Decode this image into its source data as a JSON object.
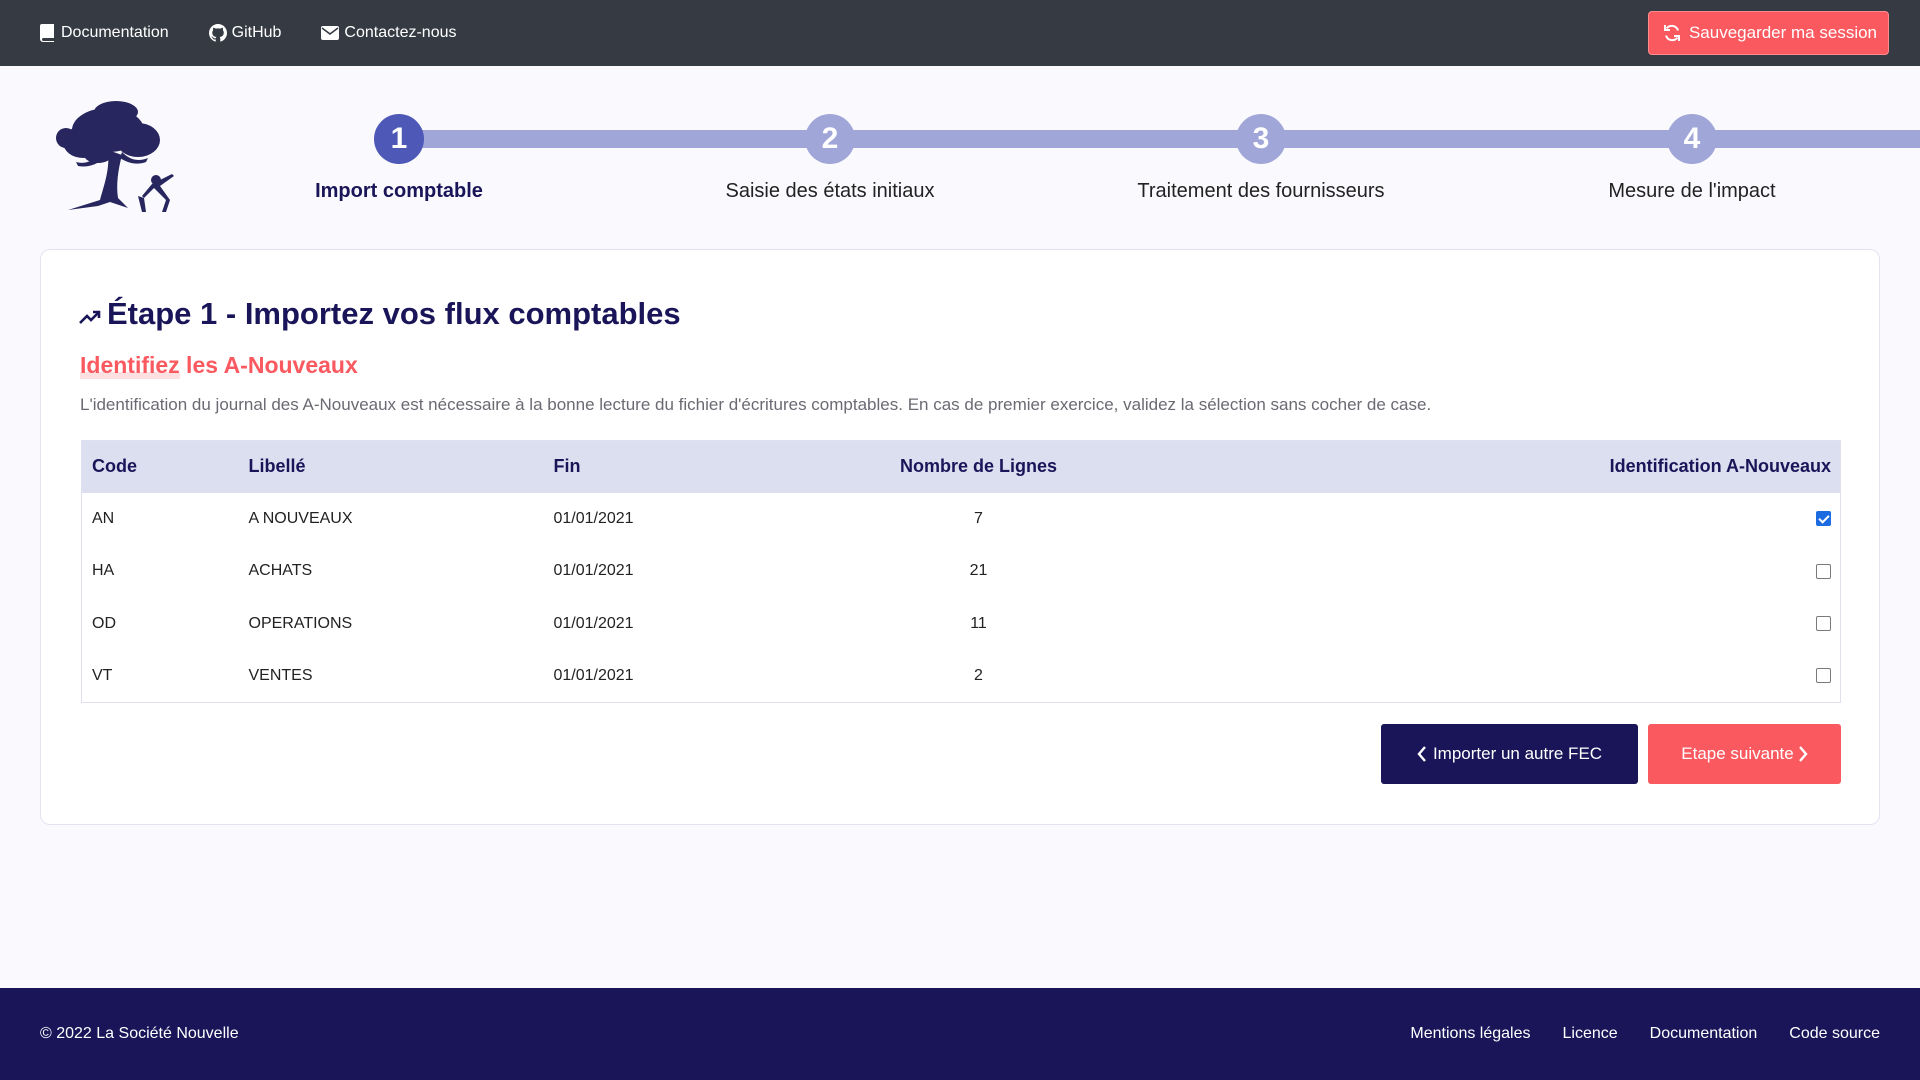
{
  "topbar": {
    "links": [
      {
        "label": "Documentation",
        "icon": "book-icon"
      },
      {
        "label": "GitHub",
        "icon": "github-icon"
      },
      {
        "label": "Contactez-nous",
        "icon": "envelope-icon"
      }
    ],
    "save_label": "Sauvegarder ma session"
  },
  "stepper": {
    "steps": [
      {
        "number": "1",
        "label": "Import comptable",
        "active": true
      },
      {
        "number": "2",
        "label": "Saisie des états initiaux",
        "active": false
      },
      {
        "number": "3",
        "label": "Traitement des fournisseurs",
        "active": false
      },
      {
        "number": "4",
        "label": "Mesure de l'impact",
        "active": false
      }
    ]
  },
  "card": {
    "title": "Étape 1 - Importez vos flux comptables",
    "subtitle": "Identifiez les A-Nouveaux",
    "description": "L'identification du journal des A-Nouveaux est nécessaire à la bonne lecture du fichier d'écritures comptables. En cas de premier exercice, validez la sélection sans cocher de case."
  },
  "table": {
    "headers": {
      "code": "Code",
      "libelle": "Libellé",
      "fin": "Fin",
      "count": "Nombre de Lignes",
      "ident": "Identification A-Nouveaux"
    },
    "rows": [
      {
        "code": "AN",
        "libelle": "A NOUVEAUX",
        "fin": "01/01/2021",
        "count": "7",
        "checked": true
      },
      {
        "code": "HA",
        "libelle": "ACHATS",
        "fin": "01/01/2021",
        "count": "21",
        "checked": false
      },
      {
        "code": "OD",
        "libelle": "OPERATIONS",
        "fin": "01/01/2021",
        "count": "11",
        "checked": false
      },
      {
        "code": "VT",
        "libelle": "VENTES",
        "fin": "01/01/2021",
        "count": "2",
        "checked": false
      }
    ]
  },
  "buttons": {
    "prev_label": "Importer un autre FEC",
    "next_label": "Etape suivante"
  },
  "footer": {
    "copyright": "© 2022 La Société Nouvelle",
    "links": [
      "Mentions légales",
      "Licence",
      "Documentation",
      "Code source"
    ]
  },
  "colors": {
    "navy": "#191558",
    "coral": "#fa595f",
    "step_active": "#4d58b7",
    "step_inactive": "#a0a6d7",
    "topbar": "#353a43"
  }
}
